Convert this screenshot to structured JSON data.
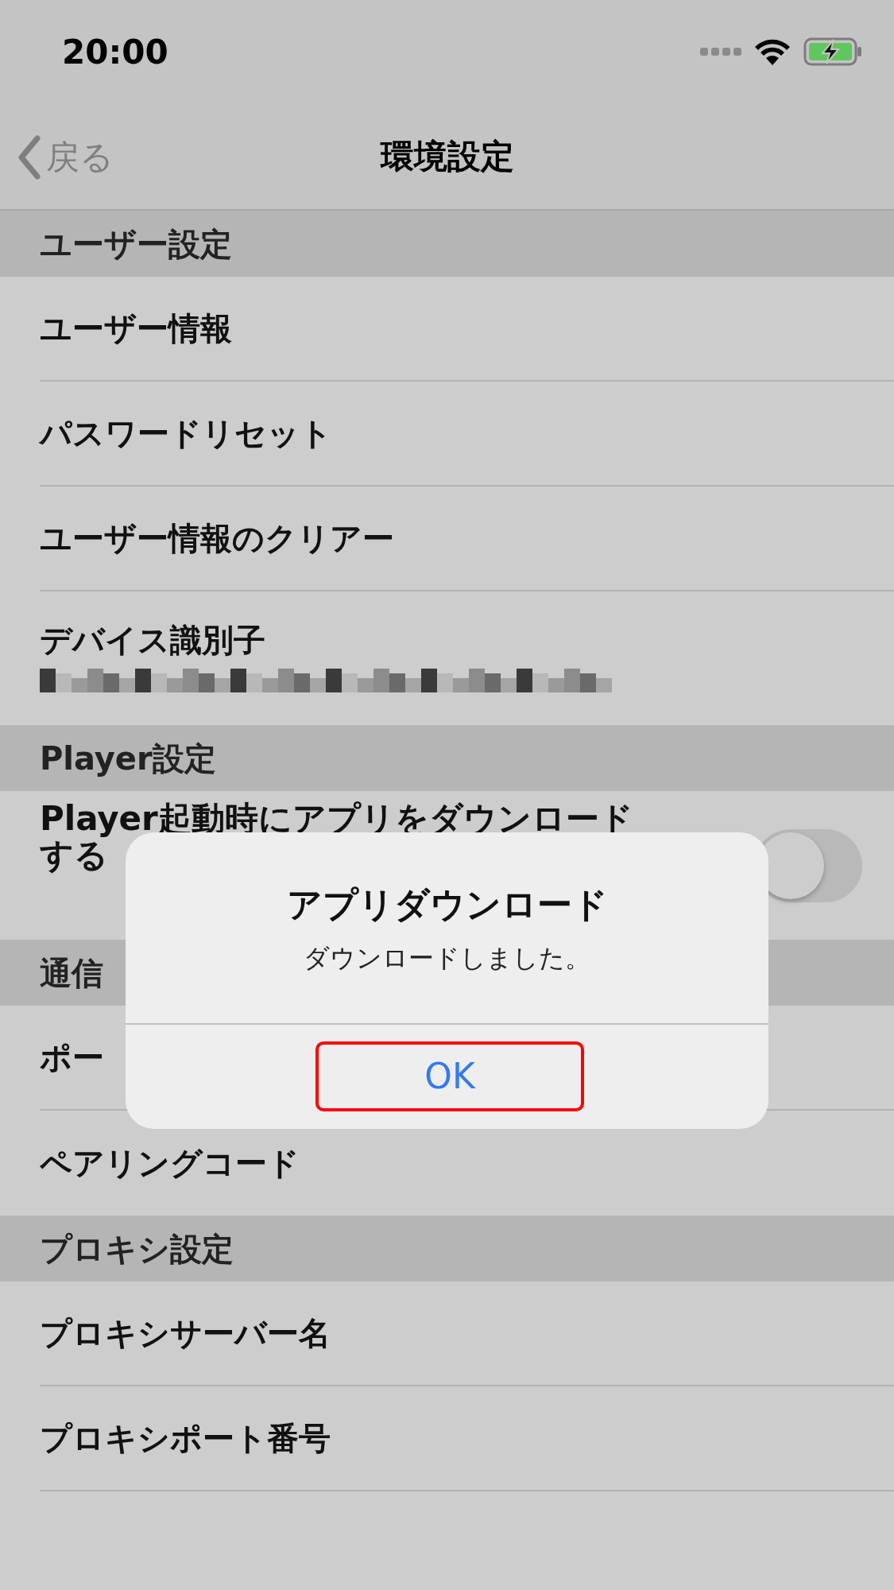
{
  "status_bar": {
    "time": "20:00",
    "battery_charging": true
  },
  "nav": {
    "back": "戻る",
    "title": "環境設定"
  },
  "sections": [
    {
      "header": "ユーザー設定",
      "rows": [
        {
          "kind": "plain",
          "label": "ユーザー情報"
        },
        {
          "kind": "plain",
          "label": "パスワードリセット"
        },
        {
          "kind": "plain",
          "label": "ユーザー情報のクリアー"
        },
        {
          "kind": "redacted",
          "label": "デバイス識別子"
        }
      ]
    },
    {
      "header": "Player設定",
      "rows": [
        {
          "kind": "toggle",
          "label": "Player起動時にアプリをダウンロードする",
          "on": false
        }
      ]
    },
    {
      "header": "通信",
      "rows": [
        {
          "kind": "plain",
          "label": "ポー"
        },
        {
          "kind": "plain",
          "label": "ペアリングコード"
        }
      ]
    },
    {
      "header": "プロキシ設定",
      "rows": [
        {
          "kind": "plain",
          "label": "プロキシサーバー名"
        },
        {
          "kind": "plain",
          "label": "プロキシポート番号"
        }
      ]
    }
  ],
  "alert": {
    "title": "アプリダウンロード",
    "message": "ダウンロードしました。",
    "button": "OK",
    "button_highlighted": true
  }
}
